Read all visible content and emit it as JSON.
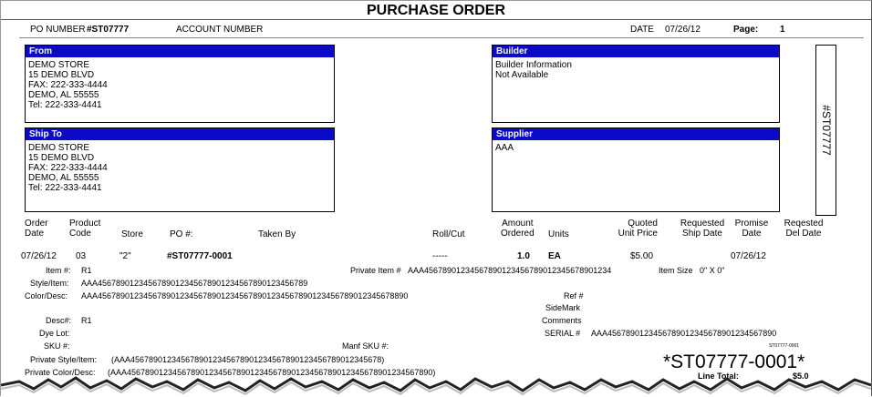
{
  "header": {
    "title": "PURCHASE ORDER",
    "po_number_label": "PO NUMBER",
    "po_number": "#ST07777",
    "account_number_label": "ACCOUNT NUMBER",
    "date_label": "DATE",
    "date": "07/26/12",
    "page_label": "Page:",
    "page": "1"
  },
  "from": {
    "heading": "From",
    "lines": [
      "DEMO STORE",
      "15  DEMO BLVD",
      "FAX: 222-333-4444",
      "DEMO, AL    55555",
      "Tel: 222-333-4441"
    ]
  },
  "builder": {
    "heading": "Builder",
    "lines": [
      "Builder Information",
      "Not Available"
    ]
  },
  "ship_to": {
    "heading": "Ship To",
    "lines": [
      "DEMO STORE",
      "15  DEMO BLVD",
      "FAX: 222-333-4444",
      "DEMO, AL    55555",
      "Tel: 222-333-4441"
    ]
  },
  "supplier": {
    "heading": "Supplier",
    "lines": [
      "AAA"
    ]
  },
  "vertical_po": "#ST07777",
  "columns": {
    "order_date": [
      "Order",
      "Date"
    ],
    "product_code": [
      "Product",
      "Code"
    ],
    "store": "Store",
    "po": "PO #:",
    "taken_by": "Taken By",
    "roll_cut": "Roll/Cut",
    "amount_ordered": [
      "Amount",
      "Ordered"
    ],
    "units": "Units",
    "quoted_unit_price": [
      "Quoted",
      "Unit Price"
    ],
    "requested_ship_date": [
      "Requested",
      "Ship Date"
    ],
    "promise_date": [
      "Promise",
      "Date"
    ],
    "reqested_del_date": [
      "Reqested",
      "Del Date"
    ]
  },
  "line": {
    "order_date": "07/26/12",
    "product_code": "03",
    "store": "\"2\"",
    "po": "#ST07777-0001",
    "roll_cut": "-----",
    "amount_ordered": "1.0",
    "units": "EA",
    "quoted_unit_price": "$5.00",
    "promise_date": "07/26/12"
  },
  "details": {
    "item_label": "Item #:",
    "item": "R1",
    "private_item_label": "Private Item #",
    "private_item": "AAA45678901234567890123456789012345678901234",
    "item_size_label": "Item Size",
    "item_size": "0\" X 0\"",
    "style_item_label": "Style/Item:",
    "style_item": "AAA4567890123456789012345678901234567890123456789",
    "color_desc_label": "Color/Desc:",
    "color_desc": "AAA45678901234567890123456789012345678901234567890123456789012345678890",
    "ref_label": "Ref #",
    "sidemark_label": "SideMark",
    "comments_label": "Comments",
    "serial_label": "SERIAL #",
    "serial": "AAA4567890123456789012345678901234567890",
    "desc_label": "Desc#:",
    "desc": "R1",
    "dye_lot_label": "Dye Lot:",
    "sku_label": "SKU #:",
    "manf_sku_label": "Manf SKU #:",
    "small_id": "ST07777-0001",
    "private_style_label": "Private Style/Item:",
    "private_style": "(AAA4567890123456789012345678901234567890123456789012345678)",
    "private_color_label": "Private Color/Desc:",
    "private_color": "(AAA4567890123456789012345678901234567890123456789012345678901234567890)",
    "big_id": "*ST07777-0001*",
    "line_total_label": "Line Total:",
    "line_total": "$5.0"
  }
}
